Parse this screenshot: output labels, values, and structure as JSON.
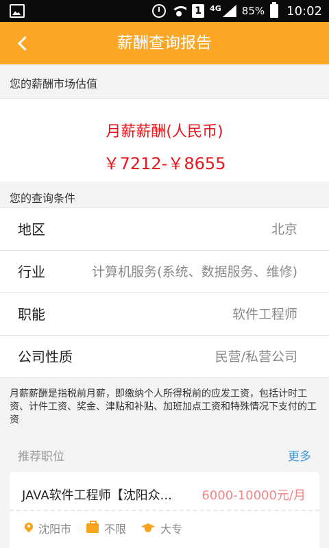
{
  "status_bar": {
    "signal_type": "4G",
    "battery": "85%",
    "time": "10:02",
    "sim_slot": "1"
  },
  "header": {
    "title": "薪酬查询报告"
  },
  "valuation": {
    "section_label": "您的薪酬市场估值",
    "salary_type": "月薪薪酬(人民币)",
    "salary_range": "￥7212-￥8655"
  },
  "conditions": {
    "section_label": "您的查询条件",
    "rows": [
      {
        "label": "地区",
        "value": "北京"
      },
      {
        "label": "行业",
        "value": "计算机服务(系统、数据服务、维修)"
      },
      {
        "label": "职能",
        "value": "软件工程师"
      },
      {
        "label": "公司性质",
        "value": "民营/私营公司"
      }
    ]
  },
  "note": "月薪薪酬是指税前月薪，即缴纳个人所得税前的应发工资，包括计时工资、计件工资、奖金、津贴和补贴、加班加点工资和特殊情况下支付的工资",
  "recommend": {
    "title": "推荐职位",
    "more_label": "更多",
    "jobs": [
      {
        "title": "JAVA软件工程师【沈阳众...",
        "salary": "6000-10000元/月",
        "city": "沈阳市",
        "experience": "不限",
        "education": "大专"
      }
    ]
  },
  "colors": {
    "accent": "#fba625",
    "price": "#e8171e",
    "link": "#3a9bdc",
    "job_salary": "#f08686"
  }
}
